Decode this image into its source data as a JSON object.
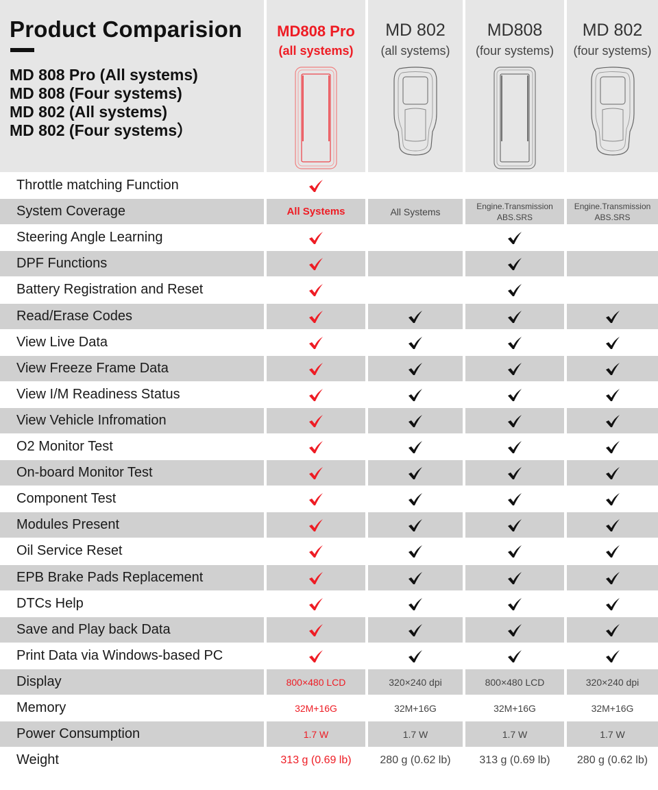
{
  "header": {
    "title": "Product Comparision",
    "models_list": [
      "MD 808 Pro (All systems)",
      "MD 808 (Four systems)",
      "MD 802 (All systems)",
      "MD 802 (Four systems）"
    ],
    "products": [
      {
        "name": "MD808 Pro",
        "subtitle": "(all systems)",
        "device_icon": "tablet-scanner-icon",
        "highlight": true
      },
      {
        "name": "MD 802",
        "subtitle": "(all systems)",
        "device_icon": "handheld-scanner-icon",
        "highlight": false
      },
      {
        "name": "MD808",
        "subtitle": "(four systems)",
        "device_icon": "tablet-scanner-icon",
        "highlight": false
      },
      {
        "name": "MD 802",
        "subtitle": "(four systems)",
        "device_icon": "handheld-scanner-icon",
        "highlight": false
      }
    ]
  },
  "colors": {
    "highlight": "#ee1c24",
    "check": "#111111",
    "header_bg": "#e6e6e6",
    "row_gray": "#d0d0d0"
  },
  "rows": [
    {
      "feature": "Throttle matching Function",
      "values": [
        true,
        false,
        false,
        false
      ]
    },
    {
      "feature": "System Coverage",
      "values": [
        "All Systems",
        "All Systems",
        "Engine.Transmission\nABS.SRS",
        "Engine.Transmission\nABS.SRS"
      ]
    },
    {
      "feature": "Steering Angle Learning",
      "values": [
        true,
        false,
        true,
        false
      ]
    },
    {
      "feature": "DPF Functions",
      "values": [
        true,
        false,
        true,
        false
      ]
    },
    {
      "feature": "Battery Registration and Reset",
      "values": [
        true,
        false,
        true,
        false
      ]
    },
    {
      "feature": "Read/Erase Codes",
      "values": [
        true,
        true,
        true,
        true
      ]
    },
    {
      "feature": "View Live Data",
      "values": [
        true,
        true,
        true,
        true
      ]
    },
    {
      "feature": "View Freeze Frame Data",
      "values": [
        true,
        true,
        true,
        true
      ]
    },
    {
      "feature": "View I/M Readiness Status",
      "values": [
        true,
        true,
        true,
        true
      ]
    },
    {
      "feature": "View Vehicle Infromation",
      "values": [
        true,
        true,
        true,
        true
      ]
    },
    {
      "feature": "O2 Monitor  Test",
      "values": [
        true,
        true,
        true,
        true
      ]
    },
    {
      "feature": "On-board Monitor Test",
      "values": [
        true,
        true,
        true,
        true
      ]
    },
    {
      "feature": "Component Test",
      "values": [
        true,
        true,
        true,
        true
      ]
    },
    {
      "feature": "Modules Present",
      "values": [
        true,
        true,
        true,
        true
      ]
    },
    {
      "feature": "Oil Service Reset",
      "values": [
        true,
        true,
        true,
        true
      ]
    },
    {
      "feature": "EPB Brake Pads Replacement",
      "values": [
        true,
        true,
        true,
        true
      ]
    },
    {
      "feature": "DTCs Help",
      "values": [
        true,
        true,
        true,
        true
      ]
    },
    {
      "feature": "Save and Play back Data",
      "values": [
        true,
        true,
        true,
        true
      ]
    },
    {
      "feature": "Print Data via Windows-based PC",
      "values": [
        true,
        true,
        true,
        true
      ]
    },
    {
      "feature": "Display",
      "values": [
        "800×480 LCD",
        "320×240 dpi",
        "800×480 LCD",
        "320×240 dpi"
      ]
    },
    {
      "feature": "Memory",
      "values": [
        "32M+16G",
        "32M+16G",
        "32M+16G",
        "32M+16G"
      ]
    },
    {
      "feature": "Power Consumption",
      "values": [
        "1.7 W",
        "1.7 W",
        "1.7 W",
        "1.7 W"
      ]
    },
    {
      "feature": "Weight",
      "values": [
        "313 g (0.69 lb)",
        "280 g (0.62 lb)",
        "313 g (0.69 lb)",
        "280 g (0.62 lb)"
      ]
    }
  ]
}
